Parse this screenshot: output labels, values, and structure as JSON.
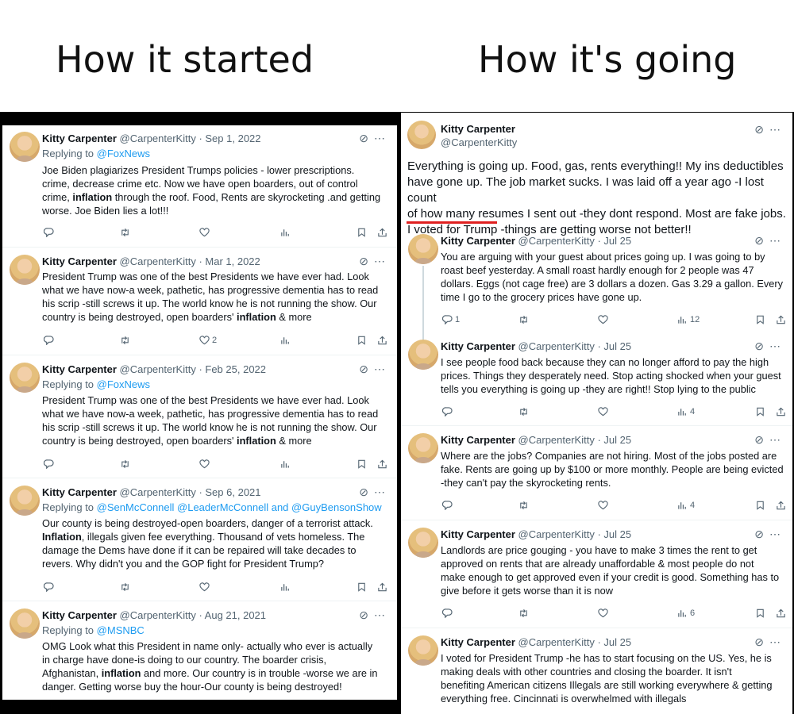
{
  "headlines": {
    "left": "How it started",
    "right": "How it's going"
  },
  "left_tweets": [
    {
      "name": "Kitty Carpenter",
      "meta": "@CarpenterKitty · Sep 1, 2022",
      "replying": "Replying to",
      "replying_to": "@FoxNews",
      "lines": [
        "Joe Biden plagiarizes President Trumps policies - lower prescriptions.",
        "crime, decrease crime etc. Now we have open boarders, out of control"
      ],
      "line3a": "crime, ",
      "bold": "inflation",
      "line3b": " through the roof. Food, Rents are skyrocketing .and getting",
      "line4": "worse. Joe Biden lies a lot!!!"
    },
    {
      "name": "Kitty Carpenter",
      "meta": "@CarpenterKitty · Mar 1, 2022",
      "lines": [
        "President Trump was one of the best Presidents we have ever had. Look",
        "what we have now-a week, pathetic, has progressive dementia has to read",
        "his scrip -still screws it up. The world know he is not running the show. Our"
      ],
      "line4a": "country is being destroyed, open boarders' ",
      "bold": "inflation",
      "line4b": " & more",
      "likes": "2"
    },
    {
      "name": "Kitty Carpenter",
      "meta": "@CarpenterKitty · Feb 25, 2022",
      "replying": "Replying to",
      "replying_to": "@FoxNews",
      "lines": [
        "President Trump was one of the best Presidents we have ever had. Look",
        "what we have now-a week, pathetic, has progressive dementia has to read",
        "his scrip -still screws it up. The world know he is not running the show. Our"
      ],
      "line4a": "country is being destroyed, open boarders' ",
      "bold": "inflation",
      "line4b": " & more"
    },
    {
      "name": "Kitty Carpenter",
      "meta": "@CarpenterKitty · Sep 6, 2021",
      "replying": "Replying to",
      "replying_to": "@SenMcConnell @LeaderMcConnell and @GuyBensonShow",
      "line1": "Our county is being destroyed-open boarders, danger of a terrorist attack.",
      "bold": "Inflation",
      "line2b": ", illegals given fee everything. Thousand of vets homeless. The",
      "lines": [
        "damage the Dems have done if it can be repaired will take decades to",
        "revers. Why didn't you and the GOP fight for President Trump?"
      ]
    },
    {
      "name": "Kitty Carpenter",
      "meta": "@CarpenterKitty · Aug 21, 2021",
      "replying": "Replying to",
      "replying_to": "@MSNBC",
      "lines": [
        "OMG Look what this President in name only- actually who ever is actually",
        "in charge have done-is doing to our country. The boarder crisis,"
      ],
      "line3a": "Afghanistan, ",
      "bold": "inflation",
      "line3b": " and more. Our country is in trouble -worse we are in",
      "line4": "danger. Getting worse buy the hour-Our county is being destroyed!"
    }
  ],
  "main_tweet": {
    "name": "Kitty Carpenter",
    "handle": "@CarpenterKitty",
    "lines": [
      "Everything is going up. Food, gas, rents everything!! My ins deductibles",
      "have gone up. The job market sucks. I was laid off a year ago -I lost count",
      "of how many resumes I sent out -they dont respond. Most are fake jobs.",
      "I voted for Trump -things are getting worse not better!!"
    ]
  },
  "right_tweets": [
    {
      "name": "Kitty Carpenter",
      "meta": "@CarpenterKitty · Jul 25",
      "lines": [
        "You are arguing with your guest about prices going up. I was going to by",
        "roast beef yesterday. A small roast hardly enough for 2 people was 47",
        "dollars. Eggs (not cage free) are 3 dollars a dozen. Gas 3.29 a gallon. Every",
        "time I go to the grocery prices have gone up."
      ],
      "replies": "1",
      "views": "12"
    },
    {
      "name": "Kitty Carpenter",
      "meta": "@CarpenterKitty · Jul 25",
      "lines": [
        "I see people food back because they can no longer afford to pay the high",
        "prices. Things they desperately need. Stop acting shocked when your guest",
        "tells you everything is going up -they are right!!  Stop lying to the public"
      ],
      "views": "4"
    },
    {
      "name": "Kitty Carpenter",
      "meta": "@CarpenterKitty · Jul 25",
      "lines": [
        "Where are the jobs? Companies are not hiring. Most of the jobs posted are",
        "fake. Rents are going up by $100 or more monthly. People are being evicted",
        "-they can't pay the skyrocketing rents."
      ],
      "views": "4"
    },
    {
      "name": "Kitty Carpenter",
      "meta": "@CarpenterKitty · Jul 25",
      "lines": [
        "Landlords are price gouging - you have to make 3 times the rent to get",
        "approved on rents that are already unaffordable & most people do not",
        "make enough to get approved even if your credit is good.  Something has to",
        "give before it gets worse than it is now"
      ],
      "views": "6"
    },
    {
      "name": "Kitty Carpenter",
      "meta": "@CarpenterKitty · Jul 25",
      "lines": [
        "I voted for President Trump -he has to start focusing on the US. Yes, he is",
        "making deals with other countries and closing the boarder. It isn't",
        "benefiting American citizens Illegals are still working everywhere & getting",
        "everything free. Cincinnati is overwhelmed with illegals"
      ]
    }
  ],
  "icons": {
    "grok": "grok-icon",
    "more": "⋯",
    "reply": "reply-icon",
    "retweet": "retweet-icon",
    "like": "heart-icon",
    "views": "views-icon",
    "bookmark": "bookmark-icon",
    "share": "share-icon"
  },
  "colors": {
    "link": "#1d9bf0",
    "underline": "#e02020",
    "muted": "#536471"
  }
}
